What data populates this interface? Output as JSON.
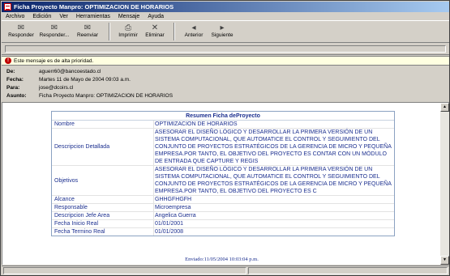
{
  "window": {
    "title": "Ficha Proyecto Manpro: OPTIMIZACION DE HORARIOS"
  },
  "menu": [
    "Archivo",
    "Edición",
    "Ver",
    "Herramientas",
    "Mensaje",
    "Ayuda"
  ],
  "toolbar": [
    {
      "label": "Responder",
      "icon": "reply-icon",
      "glyph": "✉"
    },
    {
      "label": "Responder...",
      "icon": "reply-all-icon",
      "glyph": "✉"
    },
    {
      "label": "Reenviar",
      "icon": "forward-icon",
      "glyph": "✉"
    },
    {
      "label": "Imprimir",
      "icon": "print-icon",
      "glyph": "⎙"
    },
    {
      "label": "Eliminar",
      "icon": "delete-icon",
      "glyph": "✕"
    },
    {
      "label": "Anterior",
      "icon": "previous-icon",
      "glyph": "◂"
    },
    {
      "label": "Siguiente",
      "icon": "next-icon",
      "glyph": "▸"
    }
  ],
  "infobar": {
    "text": "Este mensaje es de alta prioridad."
  },
  "headers": {
    "from_label": "De:",
    "from": "aguerr60@bancoestado.cl",
    "date_label": "Fecha:",
    "date": "Martes 11 de Mayo de 2004 09:03 a.m.",
    "to_label": "Para:",
    "to": "jose@dcoirs.cl",
    "subject_label": "Asunto:",
    "subject": "Ficha Proyecto Manpro: OPTIMIZACION DE HORARIOS"
  },
  "ficha": {
    "title": "Resumen Ficha deProyecto",
    "rows": [
      {
        "key": "Nombre",
        "value": "OPTIMIZACION DE HORARIOS"
      },
      {
        "key": "Descripcion Detallada",
        "value": "ASESORAR EL DISEÑO LÓGICO Y DESARROLLAR LA PRIMERA VERSIÓN DE UN SISTEMA COMPUTACIONAL, QUE AUTOMATICE EL CONTROL Y SEGUIMIENTO DEL CONJUNTO DE PROYECTOS ESTRATÉGICOS DE LA GERENCIA DE MICRO Y PEQUEÑA EMPRESA.POR TANTO, EL OBJETIVO DEL PROYECTO ES CONTAR CON UN MÓDULO DE ENTRADA QUE CAPTURE Y REGIS"
      },
      {
        "key": "Objetivos",
        "value": "ASESORAR EL DISEÑO LÓGICO Y DESARROLLAR LA PRIMERA VERSIÓN DE UN SISTEMA COMPUTACIONAL, QUE AUTOMATICE EL CONTROL Y SEGUIMIENTO DEL CONJUNTO DE PROYECTOS ESTRATÉGICOS DE LA GERENCIA DE MICRO Y PEQUEÑA EMPRESA.POR TANTO, EL OBJETIVO DEL PROYECTO ES C"
      },
      {
        "key": "Alcance",
        "value": "GHHGFHGFH"
      },
      {
        "key": "Responsable",
        "value": "Microempresa"
      },
      {
        "key": "Descripcion Jefe Area",
        "value": "Angelica Guerra"
      },
      {
        "key": "Fecha Inicio Real",
        "value": "01/01/2001"
      },
      {
        "key": "Fecha Termino Real",
        "value": "01/01/2008"
      }
    ]
  },
  "footer": {
    "sent": "Enviado:11/05/2004 10:03:04 p.m."
  },
  "colors": {
    "title_bar": "#0a246a",
    "table_text": "#1b2f8f",
    "infobar_bg": "#ffffe1",
    "priority": "#c00000"
  }
}
